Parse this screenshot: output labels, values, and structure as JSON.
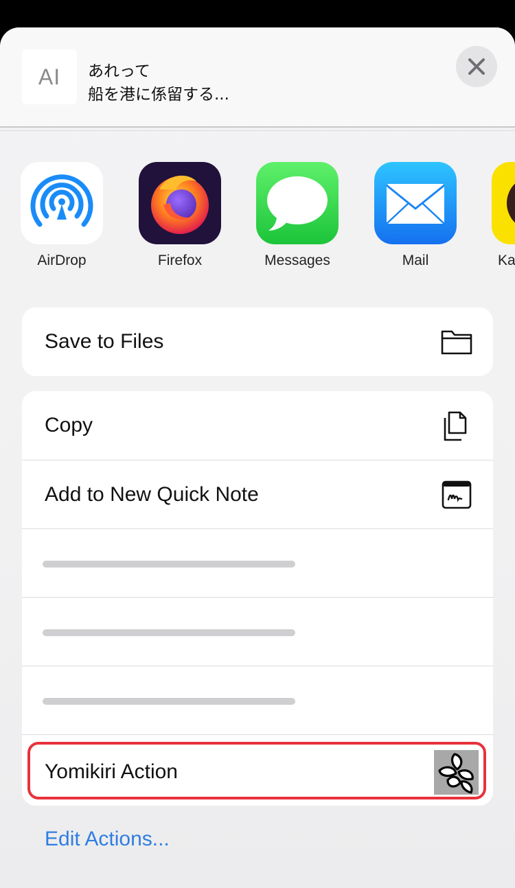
{
  "header": {
    "thumbnail_text": "AI",
    "line1": "あれって",
    "line2": "船を港に係留する..."
  },
  "apps": [
    {
      "label": "AirDrop",
      "icon": "airdrop-icon"
    },
    {
      "label": "Firefox",
      "icon": "firefox-icon"
    },
    {
      "label": "Messages",
      "icon": "messages-icon"
    },
    {
      "label": "Mail",
      "icon": "mail-icon"
    },
    {
      "label": "Ka",
      "icon": "kakao-icon"
    }
  ],
  "actions_group1": [
    {
      "label": "Save to Files",
      "icon": "folder-icon"
    }
  ],
  "actions_group2": [
    {
      "label": "Copy",
      "icon": "copy-icon"
    },
    {
      "label": "Add to New Quick Note",
      "icon": "quick-note-icon"
    }
  ],
  "yomikiri": {
    "label": "Yomikiri Action",
    "icon": "yomikiri-icon"
  },
  "edit_actions": "Edit Actions...",
  "colors": {
    "link": "#2f7de1",
    "highlight": "#e8323c",
    "messages_green": "#34c759",
    "mail_blue": "#1a8cf7",
    "kakao_yellow": "#fae100"
  }
}
